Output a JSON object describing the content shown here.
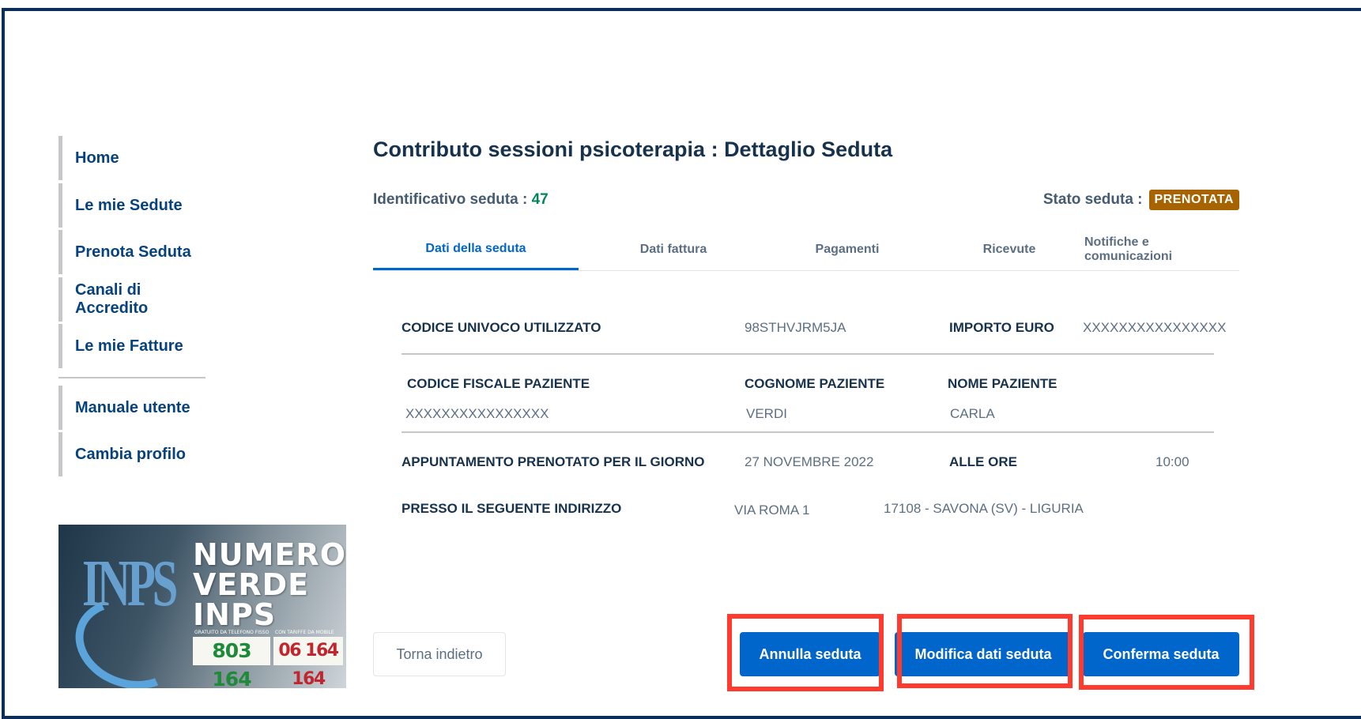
{
  "sidebar": {
    "items": [
      {
        "label": "Home"
      },
      {
        "label": "Le mie Sedute"
      },
      {
        "label": "Prenota Seduta"
      },
      {
        "label": "Canali di Accredito"
      },
      {
        "label": "Le mie Fatture"
      },
      {
        "label": "Manuale utente"
      },
      {
        "label": "Cambia profilo"
      }
    ]
  },
  "banner": {
    "logo": "INPS",
    "line1": "NUMERO",
    "line2": "VERDE",
    "line3": "INPS",
    "fixed_caption": "GRATUITO DA TELEFONO FISSO",
    "mobile_caption": "CON TARIFFE DA MOBILE",
    "fixed_number": "803 164",
    "mobile_number": "06 164 164"
  },
  "page": {
    "title": "Contributo sessioni psicoterapia : Dettaglio Seduta",
    "id_label": "Identificativo seduta :",
    "id_value": "47",
    "status_label": "Stato seduta :",
    "status_value": "PRENOTATA"
  },
  "tabs": [
    {
      "label": "Dati della seduta"
    },
    {
      "label": "Dati fattura"
    },
    {
      "label": "Pagamenti"
    },
    {
      "label": "Ricevute"
    },
    {
      "label": "Notifiche e comunicazioni"
    }
  ],
  "details": {
    "codice_label": "CODICE UNIVOCO UTILIZZATO",
    "codice_value": "98STHVJRM5JA",
    "importo_label": "IMPORTO EURO",
    "importo_value": "XXXXXXXXXXXXXXXX",
    "cf_label": "CODICE FISCALE PAZIENTE",
    "cf_value": "XXXXXXXXXXXXXXXX",
    "cognome_label": "COGNOME PAZIENTE",
    "cognome_value": "VERDI",
    "nome_label": "NOME PAZIENTE",
    "nome_value": "CARLA",
    "appuntamento_label": "APPUNTAMENTO PRENOTATO PER IL GIORNO",
    "appuntamento_value": "27 NOVEMBRE 2022",
    "ore_label": "ALLE ORE",
    "ore_value": "10:00",
    "indirizzo_label": "PRESSO IL SEGUENTE INDIRIZZO",
    "indirizzo_via": "VIA ROMA 1",
    "indirizzo_citta": "17108 - SAVONA (SV) - LIGURIA"
  },
  "buttons": {
    "back": "Torna indietro",
    "annulla": "Annulla seduta",
    "modifica": "Modifica dati seduta",
    "conferma": "Conferma seduta"
  },
  "colors": {
    "brand_blue": "#0066cc",
    "nav_blue": "#06437e",
    "status_badge": "#a66300",
    "highlight": "#ff3b2f"
  }
}
